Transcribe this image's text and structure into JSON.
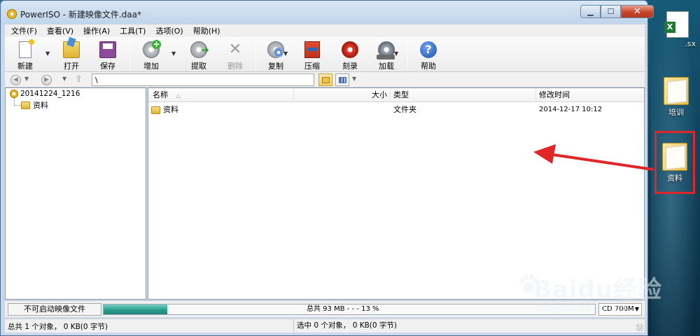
{
  "window": {
    "title": "PowerISO - 新建映像文件.daa*",
    "controls": {
      "minimize": "▁",
      "maximize": "☐",
      "close": "✕"
    }
  },
  "menu": [
    "文件(F)",
    "查看(V)",
    "操作(A)",
    "工具(T)",
    "选项(O)",
    "帮助(H)"
  ],
  "toolbar": {
    "new": "新建",
    "open": "打开",
    "save": "保存",
    "add": "增加",
    "extract": "提取",
    "delete": "删除",
    "copy": "复制",
    "compress": "压缩",
    "burn": "刻录",
    "mount": "加载",
    "help": "帮助"
  },
  "address": {
    "path": "\\"
  },
  "tree": {
    "root": "20141224_1216",
    "children": [
      "资料"
    ]
  },
  "columns": {
    "name": "名称",
    "size": "大小",
    "type": "类型",
    "modified": "修改时间"
  },
  "files": [
    {
      "name": "资料",
      "size": "",
      "type": "文件夹",
      "modified": "2014-12-17 10:12"
    }
  ],
  "statusbar": {
    "boot": "不可启动映像文件",
    "capacity_text": "总共  93 MB   - - -  13 %",
    "capacity_percent": 13,
    "media": "CD 700M",
    "left": "总共 1 个对象， 0 KB(0 字节)",
    "right": "选中 0 个对象， 0 KB(0 字节)"
  },
  "desktop": {
    "icons": [
      {
        "label": ".sx"
      },
      {
        "label": "培训"
      },
      {
        "label": "资料"
      }
    ]
  },
  "watermark": {
    "main": "Baidu经验",
    "sub": "jingyan.baidu.com"
  },
  "colors": {
    "annotation_red": "#e02626",
    "progress_fill": "#2a9d8f",
    "title_bar": "#c0d5ea"
  }
}
